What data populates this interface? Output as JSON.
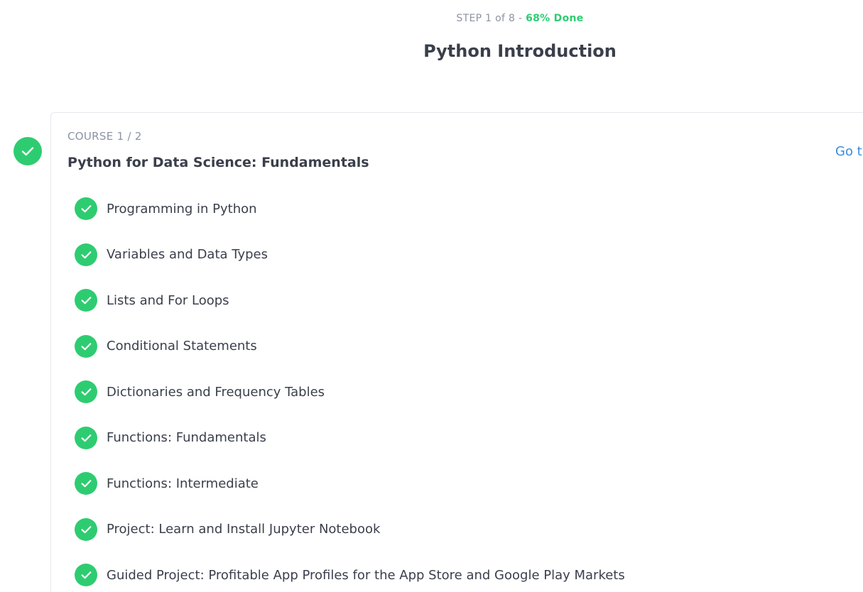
{
  "header": {
    "step_prefix": "STEP",
    "step_current": "1",
    "step_of": "of",
    "step_total": "8",
    "separator": "-",
    "done_text": "68% Done",
    "progress_percent": 68
  },
  "page_title": "Python Introduction",
  "course": {
    "label_prefix": "COURSE",
    "label_index": "1 / 2",
    "title": "Python for Data Science: Fundamentals",
    "link_text": "Go t",
    "status": "completed",
    "status_icon": "checkmark-icon",
    "lessons": [
      {
        "label": "Programming in Python",
        "status": "completed"
      },
      {
        "label": "Variables and Data Types",
        "status": "completed"
      },
      {
        "label": "Lists and For Loops",
        "status": "completed"
      },
      {
        "label": "Conditional Statements",
        "status": "completed"
      },
      {
        "label": "Dictionaries and Frequency Tables",
        "status": "completed"
      },
      {
        "label": "Functions: Fundamentals",
        "status": "completed"
      },
      {
        "label": "Functions: Intermediate",
        "status": "completed"
      },
      {
        "label": "Project: Learn and Install Jupyter Notebook",
        "status": "completed"
      },
      {
        "label": "Guided Project: Profitable App Profiles for the App Store and Google Play Markets",
        "status": "completed"
      }
    ]
  },
  "colors": {
    "accent_green": "#2ecc71",
    "link_blue": "#3b8ddd",
    "text_dark": "#3a3f4b",
    "text_muted": "#8c93a3",
    "card_border": "#e5e7eb"
  }
}
